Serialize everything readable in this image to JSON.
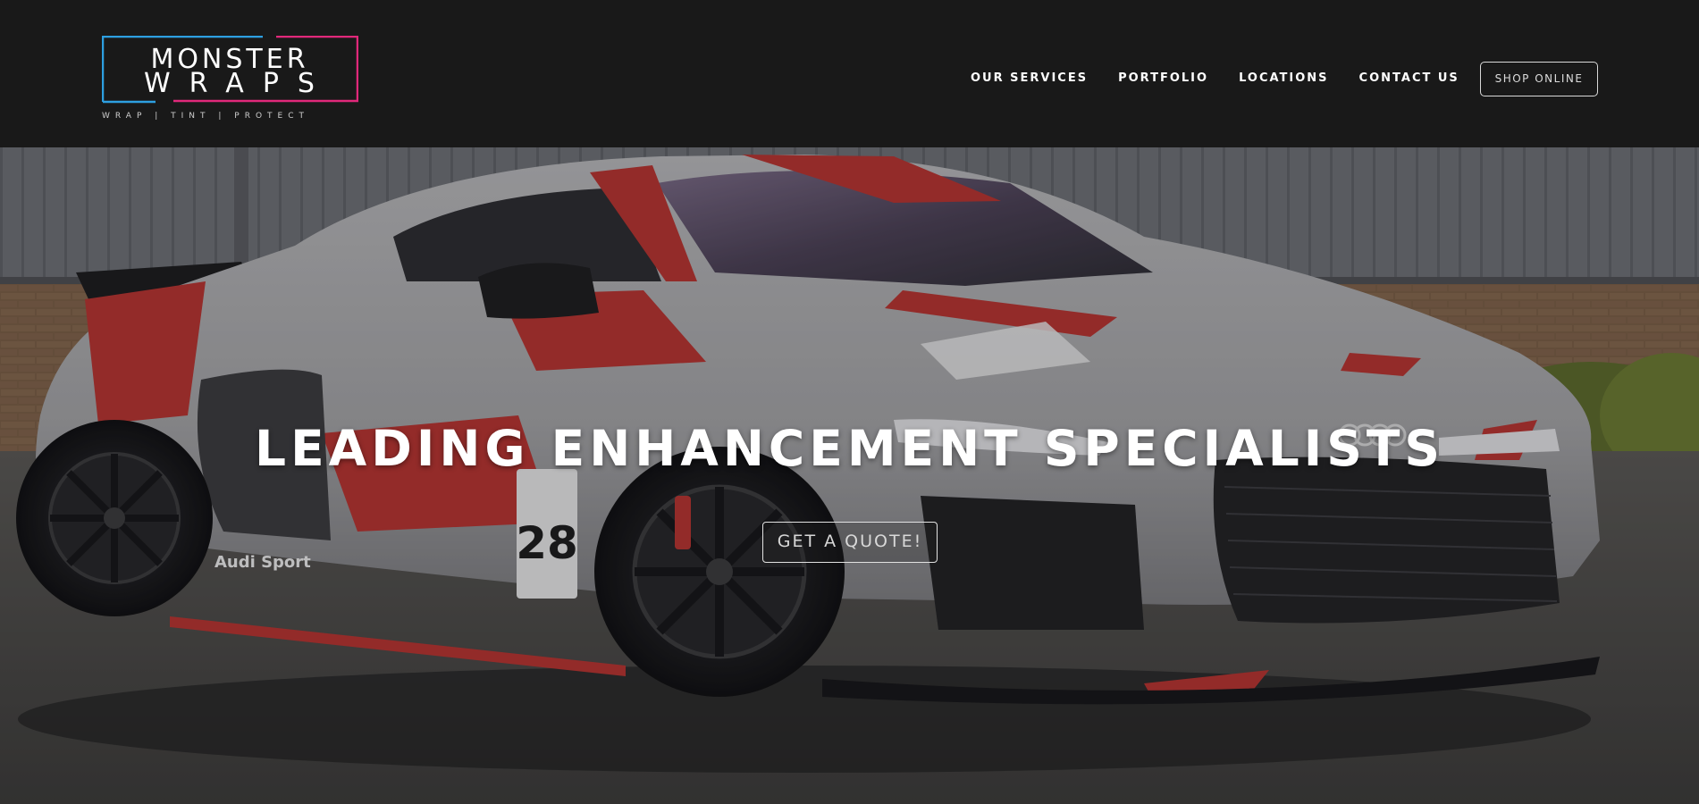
{
  "brand": {
    "line1": "MONSTER",
    "line2": "WRAPS",
    "tagline": "WRAP   |   TINT   |   PROTECT",
    "colors": {
      "blue": "#2d9fe0",
      "pink": "#e0287a"
    }
  },
  "nav": {
    "items": [
      {
        "label": "OUR SERVICES"
      },
      {
        "label": "PORTFOLIO"
      },
      {
        "label": "LOCATIONS"
      },
      {
        "label": "CONTACT US"
      }
    ],
    "shop_label": "SHOP ONLINE"
  },
  "hero": {
    "title": "LEADING ENHANCEMENT SPECIALISTS",
    "cta_label": "GET A QUOTE!",
    "image_subject": "grey race-livery supercar with red stripes, number 28, Audi Sport decals"
  },
  "car": {
    "race_number": "28",
    "door_decal": "Audi Sport"
  }
}
